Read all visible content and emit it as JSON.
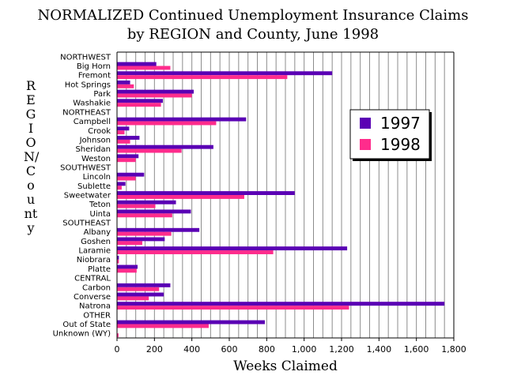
{
  "title_line1": "NORMALIZED Continued Unemployment Insurance Claims",
  "title_line2": "by REGION and County, June 1998",
  "chart_data": {
    "type": "bar",
    "orientation": "horizontal",
    "title": "NORMALIZED Continued Unemployment Insurance Claims by REGION and County, June 1998",
    "xlabel": "Weeks Claimed",
    "ylabel": "REGION/County",
    "xlim": [
      0,
      1800
    ],
    "xticks": [
      "0",
      "200",
      "400",
      "600",
      "800",
      "1,000",
      "1,200",
      "1,400",
      "1,600",
      "1,800"
    ],
    "grid": true,
    "legend": "right",
    "colors": {
      "1997": "#5a00b4",
      "1998": "#ff2c8c"
    },
    "rows": [
      {
        "label": "NORTHWEST",
        "v1997": null,
        "v1998": null
      },
      {
        "label": "Big Horn",
        "v1997": 210,
        "v1998": 285
      },
      {
        "label": "Fremont",
        "v1997": 1150,
        "v1998": 910
      },
      {
        "label": "Hot Springs",
        "v1997": 70,
        "v1998": 90
      },
      {
        "label": "Park",
        "v1997": 410,
        "v1998": 400
      },
      {
        "label": "Washakie",
        "v1997": 245,
        "v1998": 235
      },
      {
        "label": "NORTHEAST",
        "v1997": null,
        "v1998": null
      },
      {
        "label": "Campbell",
        "v1997": 690,
        "v1998": 530
      },
      {
        "label": "Crook",
        "v1997": 65,
        "v1998": 40
      },
      {
        "label": "Johnson",
        "v1997": 120,
        "v1998": 70
      },
      {
        "label": "Sheridan",
        "v1997": 515,
        "v1998": 345
      },
      {
        "label": "Weston",
        "v1997": 115,
        "v1998": 100
      },
      {
        "label": "SOUTHWEST",
        "v1997": null,
        "v1998": null
      },
      {
        "label": "Lincoln",
        "v1997": 145,
        "v1998": 100
      },
      {
        "label": "Sublette",
        "v1997": 45,
        "v1998": 25
      },
      {
        "label": "Sweetwater",
        "v1997": 950,
        "v1998": 680
      },
      {
        "label": "Teton",
        "v1997": 315,
        "v1998": 205
      },
      {
        "label": "Uinta",
        "v1997": 395,
        "v1998": 295
      },
      {
        "label": "SOUTHEAST",
        "v1997": null,
        "v1998": null
      },
      {
        "label": "Albany",
        "v1997": 440,
        "v1998": 290
      },
      {
        "label": "Goshen",
        "v1997": 255,
        "v1998": 135
      },
      {
        "label": "Laramie",
        "v1997": 1230,
        "v1998": 835
      },
      {
        "label": "Niobrara",
        "v1997": 10,
        "v1998": 10
      },
      {
        "label": "Platte",
        "v1997": 110,
        "v1998": 105
      },
      {
        "label": "CENTRAL",
        "v1997": null,
        "v1998": null
      },
      {
        "label": "Carbon",
        "v1997": 285,
        "v1998": 225
      },
      {
        "label": "Converse",
        "v1997": 250,
        "v1998": 170
      },
      {
        "label": "Natrona",
        "v1997": 1750,
        "v1998": 1240
      },
      {
        "label": "OTHER",
        "v1997": null,
        "v1998": null
      },
      {
        "label": "Out of State",
        "v1997": 790,
        "v1998": 490
      },
      {
        "label": "Unknown (WY)",
        "v1997": 0,
        "v1998": 8
      }
    ],
    "series": [
      {
        "name": "1997",
        "key": "v1997"
      },
      {
        "name": "1998",
        "key": "v1998"
      }
    ]
  }
}
